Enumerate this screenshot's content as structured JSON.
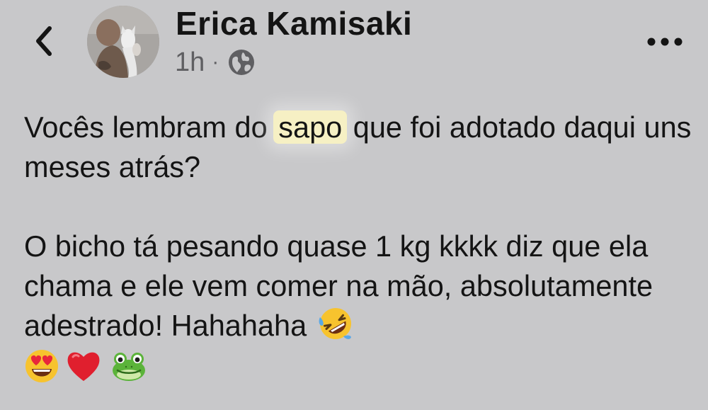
{
  "header": {
    "author_name": "Erica Kamisaki",
    "time": "1h",
    "separator": "·",
    "privacy_icon": "globe-icon",
    "back_icon": "chevron-left-icon",
    "more_icon": "more-horizontal-icon"
  },
  "post": {
    "line1_before": "Vocês lembram do",
    "highlighted_word": "sapo",
    "line1_after": "que foi adotado daqui uns meses atrás?",
    "paragraph2": "O bicho tá pesando quase 1 kg kkkk diz que ela chama e ele vem comer na mão, absolutamente adestrado! Hahahaha",
    "emojis": [
      "rolling-on-floor-laughing-emoji",
      "heart-eyes-emoji",
      "red-heart-emoji",
      "frog-emoji"
    ]
  },
  "colors": {
    "background": "#c8c8ca",
    "text": "#141414",
    "meta": "#5f5f62",
    "highlight": "#f6f0c4"
  }
}
